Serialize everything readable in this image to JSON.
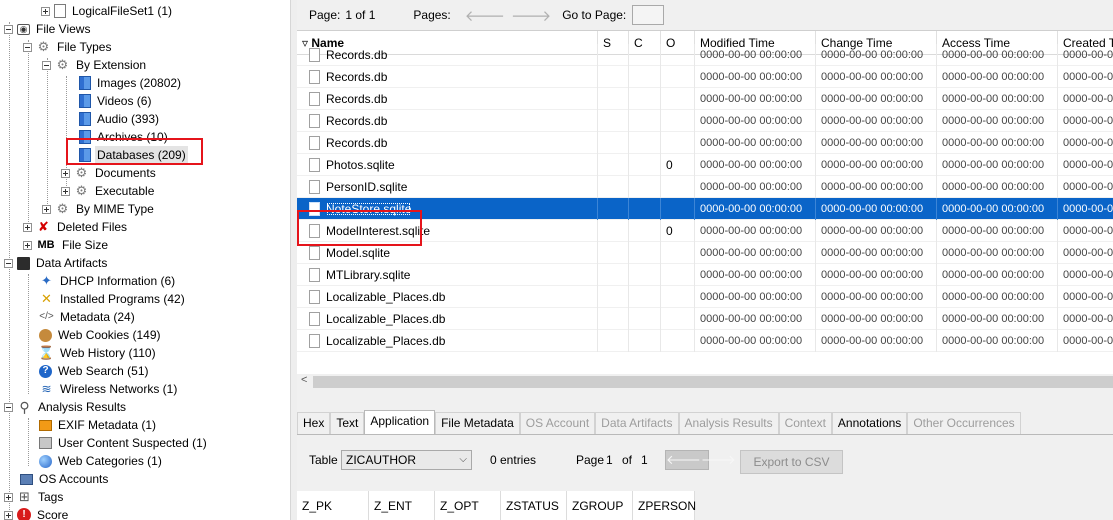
{
  "tree": {
    "nodes": [
      {
        "label": "LogicalFileSet1 (1)",
        "icon": "file-icon"
      },
      {
        "label": "File Views",
        "icon": "eye-icon"
      },
      {
        "label": "File Types",
        "icon": "gear-icon"
      },
      {
        "label": "By Extension",
        "icon": "gear-icon"
      },
      {
        "label": "Images (20802)",
        "icon": "blue-document-icon"
      },
      {
        "label": "Videos (6)",
        "icon": "blue-document-icon"
      },
      {
        "label": "Audio (393)",
        "icon": "blue-document-icon"
      },
      {
        "label": "Archives (10)",
        "icon": "blue-document-icon"
      },
      {
        "label": "Databases (209)",
        "icon": "blue-document-icon"
      },
      {
        "label": "Documents",
        "icon": "gear-icon"
      },
      {
        "label": "Executable",
        "icon": "gear-icon"
      },
      {
        "label": "By MIME Type",
        "icon": "gear-icon"
      },
      {
        "label": "Deleted Files",
        "icon": "red-x-icon"
      },
      {
        "label": "File Size",
        "icon": "mb-icon",
        "icon_text": "MB"
      },
      {
        "label": "Data Artifacts",
        "icon": "data-artifacts-icon"
      },
      {
        "label": "DHCP Information (6)",
        "icon": "dhcp-icon"
      },
      {
        "label": "Installed Programs (42)",
        "icon": "installed-programs-icon"
      },
      {
        "label": "Metadata (24)",
        "icon": "code-icon"
      },
      {
        "label": "Web Cookies (149)",
        "icon": "cookie-icon"
      },
      {
        "label": "Web History (110)",
        "icon": "hourglass-icon"
      },
      {
        "label": "Web Search (51)",
        "icon": "help-icon"
      },
      {
        "label": "Wireless Networks (1)",
        "icon": "wifi-icon"
      },
      {
        "label": "Analysis Results",
        "icon": "search-icon"
      },
      {
        "label": "EXIF Metadata (1)",
        "icon": "exif-icon"
      },
      {
        "label": "User Content Suspected (1)",
        "icon": "user-content-icon"
      },
      {
        "label": "Web Categories (1)",
        "icon": "globe-icon"
      },
      {
        "label": "OS Accounts",
        "icon": "os-accounts-icon"
      },
      {
        "label": "Tags",
        "icon": "tag-icon"
      },
      {
        "label": "Score",
        "icon": "score-icon"
      }
    ]
  },
  "pager": {
    "page_label": "Page:",
    "page_value": "1 of 1",
    "pages_label": "Pages:",
    "goto_label": "Go to Page:",
    "goto_value": ""
  },
  "table": {
    "columns": [
      "Name",
      "S",
      "C",
      "O",
      "Modified Time",
      "Change Time",
      "Access Time",
      "Created T"
    ],
    "rows": [
      {
        "name": "Records.db",
        "o": "",
        "mtime": "0000-00-00 00:00:00",
        "ctime": "0000-00-00 00:00:00",
        "atime": "0000-00-00 00:00:00",
        "crtime": "0000-00-00"
      },
      {
        "name": "Records.db",
        "o": "",
        "mtime": "0000-00-00 00:00:00",
        "ctime": "0000-00-00 00:00:00",
        "atime": "0000-00-00 00:00:00",
        "crtime": "0000-00-00"
      },
      {
        "name": "Records.db",
        "o": "",
        "mtime": "0000-00-00 00:00:00",
        "ctime": "0000-00-00 00:00:00",
        "atime": "0000-00-00 00:00:00",
        "crtime": "0000-00-00"
      },
      {
        "name": "Records.db",
        "o": "",
        "mtime": "0000-00-00 00:00:00",
        "ctime": "0000-00-00 00:00:00",
        "atime": "0000-00-00 00:00:00",
        "crtime": "0000-00-00"
      },
      {
        "name": "Records.db",
        "o": "",
        "mtime": "0000-00-00 00:00:00",
        "ctime": "0000-00-00 00:00:00",
        "atime": "0000-00-00 00:00:00",
        "crtime": "0000-00-00"
      },
      {
        "name": "Photos.sqlite",
        "o": "0",
        "mtime": "0000-00-00 00:00:00",
        "ctime": "0000-00-00 00:00:00",
        "atime": "0000-00-00 00:00:00",
        "crtime": "0000-00-00"
      },
      {
        "name": "PersonID.sqlite",
        "o": "",
        "mtime": "0000-00-00 00:00:00",
        "ctime": "0000-00-00 00:00:00",
        "atime": "0000-00-00 00:00:00",
        "crtime": "0000-00-00"
      },
      {
        "name": "NoteStore.sqlite",
        "o": "",
        "mtime": "0000-00-00 00:00:00",
        "ctime": "0000-00-00 00:00:00",
        "atime": "0000-00-00 00:00:00",
        "crtime": "0000-00-00",
        "selected": true
      },
      {
        "name": "ModelInterest.sqlite",
        "o": "0",
        "mtime": "0000-00-00 00:00:00",
        "ctime": "0000-00-00 00:00:00",
        "atime": "0000-00-00 00:00:00",
        "crtime": "0000-00-00"
      },
      {
        "name": "Model.sqlite",
        "o": "",
        "mtime": "0000-00-00 00:00:00",
        "ctime": "0000-00-00 00:00:00",
        "atime": "0000-00-00 00:00:00",
        "crtime": "0000-00-00"
      },
      {
        "name": "MTLibrary.sqlite",
        "o": "",
        "mtime": "0000-00-00 00:00:00",
        "ctime": "0000-00-00 00:00:00",
        "atime": "0000-00-00 00:00:00",
        "crtime": "0000-00-00"
      },
      {
        "name": "Localizable_Places.db",
        "o": "",
        "mtime": "0000-00-00 00:00:00",
        "ctime": "0000-00-00 00:00:00",
        "atime": "0000-00-00 00:00:00",
        "crtime": "0000-00-00"
      },
      {
        "name": "Localizable_Places.db",
        "o": "",
        "mtime": "0000-00-00 00:00:00",
        "ctime": "0000-00-00 00:00:00",
        "atime": "0000-00-00 00:00:00",
        "crtime": "0000-00-00"
      },
      {
        "name": "Localizable_Places.db",
        "o": "",
        "mtime": "0000-00-00 00:00:00",
        "ctime": "0000-00-00 00:00:00",
        "atime": "0000-00-00 00:00:00",
        "crtime": "0000-00-00"
      }
    ]
  },
  "tabs": [
    {
      "label": "Hex",
      "enabled": true
    },
    {
      "label": "Text",
      "enabled": true
    },
    {
      "label": "Application",
      "enabled": true,
      "active": true
    },
    {
      "label": "File Metadata",
      "enabled": true
    },
    {
      "label": "OS Account",
      "enabled": false
    },
    {
      "label": "Data Artifacts",
      "enabled": false
    },
    {
      "label": "Analysis Results",
      "enabled": false
    },
    {
      "label": "Context",
      "enabled": false
    },
    {
      "label": "Annotations",
      "enabled": true
    },
    {
      "label": "Other Occurrences",
      "enabled": false
    }
  ],
  "app_viewer": {
    "table_label": "Table",
    "table_selected": "ZICAUTHOR",
    "entries_text": "0 entries",
    "page_label": "Page",
    "page_current": "1",
    "page_of": "of",
    "page_total": "1",
    "export_label": "Export to CSV",
    "columns": [
      "Z_PK",
      "Z_ENT",
      "Z_OPT",
      "ZSTATUS",
      "ZGROUP",
      "ZPERSON"
    ]
  },
  "colors": {
    "selection": "#0a64c8",
    "highlight_box": "#e5141b",
    "panel_bg": "#f0f0f0"
  }
}
